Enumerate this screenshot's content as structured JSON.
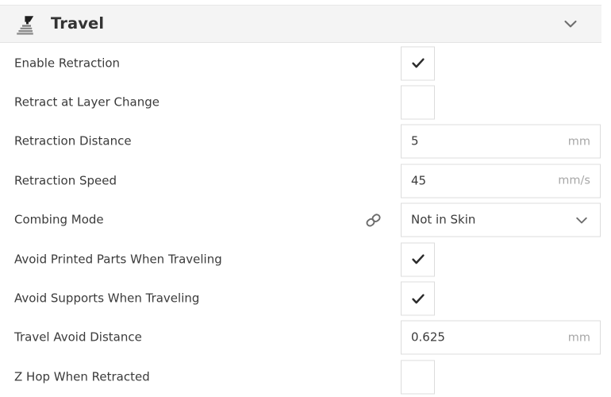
{
  "header": {
    "title": "Travel",
    "icon": "travel-nozzle-icon",
    "collapse_icon": "chevron-down-icon",
    "background": "#f4f4f4"
  },
  "theme": {
    "text": "#3b3b3b",
    "unit_text": "#a7a7a7",
    "border": "#dcdcdc",
    "checkmark": "#2b2b2b"
  },
  "settings": [
    {
      "label": "Enable Retraction",
      "type": "checkbox",
      "checked": true,
      "linked": false
    },
    {
      "label": "Retract at Layer Change",
      "type": "checkbox",
      "checked": false,
      "linked": false
    },
    {
      "label": "Retraction Distance",
      "type": "number",
      "value": "5",
      "unit": "mm",
      "linked": false
    },
    {
      "label": "Retraction Speed",
      "type": "number",
      "value": "45",
      "unit": "mm/s",
      "linked": false
    },
    {
      "label": "Combing Mode",
      "type": "dropdown",
      "value": "Not in Skin",
      "linked": true,
      "link_icon": "link-chain-icon"
    },
    {
      "label": "Avoid Printed Parts When Traveling",
      "type": "checkbox",
      "checked": true,
      "linked": false
    },
    {
      "label": "Avoid Supports When Traveling",
      "type": "checkbox",
      "checked": true,
      "linked": false
    },
    {
      "label": "Travel Avoid Distance",
      "type": "number",
      "value": "0.625",
      "unit": "mm",
      "linked": false
    },
    {
      "label": "Z Hop When Retracted",
      "type": "checkbox",
      "checked": false,
      "linked": false
    }
  ]
}
